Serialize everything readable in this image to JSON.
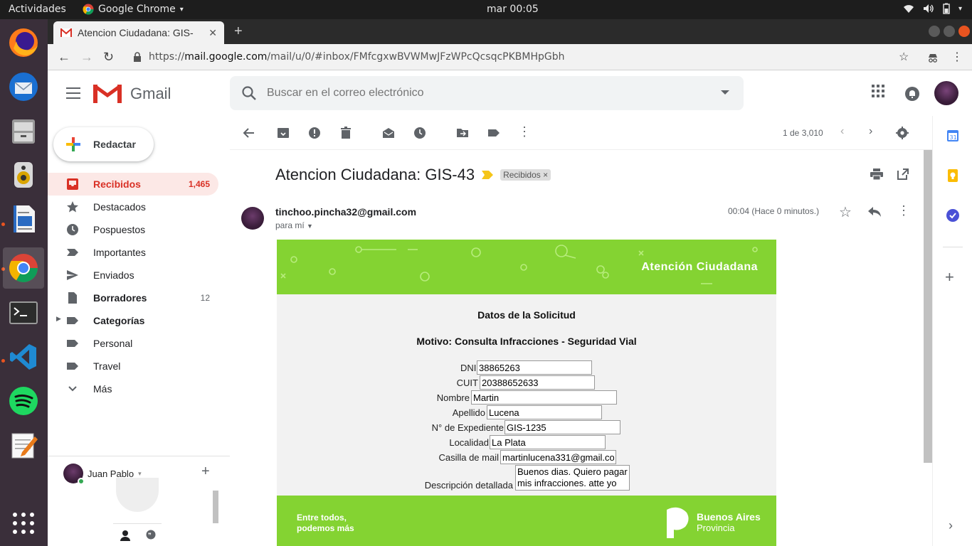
{
  "os": {
    "activities": "Actividades",
    "app_name": "Google Chrome",
    "clock": "mar 00:05"
  },
  "browser": {
    "tab_title": "Atencion Ciudadana: GIS-",
    "url_prefix": "https://",
    "url_host": "mail.google.com",
    "url_path": "/mail/u/0/#inbox/FMfcgxwBVWMwJFzWPcQcsqcPKBMHpGbh"
  },
  "gmail": {
    "logo_text": "Gmail",
    "search_placeholder": "Buscar en el correo electrónico",
    "compose_label": "Redactar",
    "nav": [
      {
        "label": "Recibidos",
        "count": "1,465"
      },
      {
        "label": "Destacados",
        "count": ""
      },
      {
        "label": "Pospuestos",
        "count": ""
      },
      {
        "label": "Importantes",
        "count": ""
      },
      {
        "label": "Enviados",
        "count": ""
      },
      {
        "label": "Borradores",
        "count": "12"
      },
      {
        "label": "Categorías",
        "count": ""
      },
      {
        "label": "Personal",
        "count": ""
      },
      {
        "label": "Travel",
        "count": ""
      },
      {
        "label": "Más",
        "count": ""
      }
    ],
    "hangouts_user": "Juan Pablo",
    "pager": "1 de 3,010"
  },
  "message": {
    "subject": "Atencion Ciudadana: GIS-43",
    "label": "Recibidos",
    "sender": "tinchoo.pincha32@gmail.com",
    "to": "para mí",
    "time": "00:04 (Hace 0 minutos.)"
  },
  "email_body": {
    "banner_title": "Atención Ciudadana",
    "heading": "Datos de la Solicitud",
    "motivo": "Motivo: Consulta Infracciones - Seguridad Vial",
    "fields": [
      {
        "label": "DNI",
        "value": "38865263"
      },
      {
        "label": "CUIT",
        "value": "20388652633"
      },
      {
        "label": "Nombre",
        "value": "Martin"
      },
      {
        "label": "Apellido",
        "value": "Lucena"
      },
      {
        "label": "N° de Expediente",
        "value": "GIS-1235"
      },
      {
        "label": "Localidad",
        "value": "La Plata"
      },
      {
        "label": "Casilla de mail",
        "value": "martinlucena331@gmail.co"
      }
    ],
    "description_label": "Descripción detallada",
    "description_value": "Buenos dias. Quiero pagar mis infracciones. atte yo",
    "footer_slogan_1": "Entre todos,",
    "footer_slogan_2": "podemos más",
    "footer_brand_1": "Buenos Aires",
    "footer_brand_2": "Provincia"
  },
  "colors": {
    "gmail_red": "#d93025",
    "green_banner": "#84d332",
    "dock_bg": "#3a2f3a",
    "topbar_bg": "#1d1d1d"
  }
}
